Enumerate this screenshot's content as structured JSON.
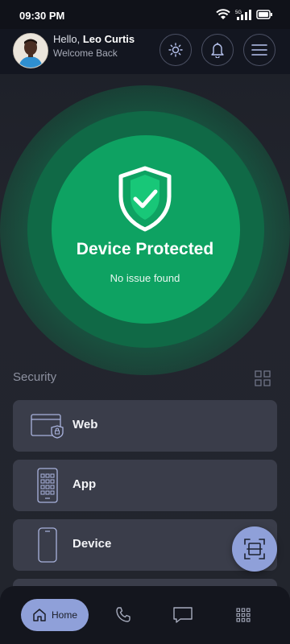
{
  "status_bar": {
    "time": "09:30 PM",
    "icons": [
      "wifi-icon",
      "signal-5g-icon",
      "battery-icon"
    ]
  },
  "header": {
    "greeting_prefix": "Hello, ",
    "user_name": "Leo Curtis",
    "welcome": "Welcome Back",
    "buttons": [
      "brightness-icon",
      "bell-icon",
      "menu-icon"
    ]
  },
  "hero": {
    "title": "Device Protected",
    "subtitle": "No issue found",
    "accent": "#0ea262"
  },
  "security": {
    "title": "Security",
    "items": [
      {
        "label": "Web",
        "icon": "browser-shield-icon"
      },
      {
        "label": "App",
        "icon": "phone-apps-icon"
      },
      {
        "label": "Device",
        "icon": "phone-icon"
      }
    ]
  },
  "bottom_nav": {
    "items": [
      {
        "label": "Home",
        "icon": "home-icon",
        "active": true
      },
      {
        "label": "",
        "icon": "phone-call-icon"
      },
      {
        "label": "",
        "icon": "chat-icon"
      },
      {
        "label": "",
        "icon": "apps-grid-icon"
      }
    ],
    "active_color": "#8fa0d9"
  }
}
